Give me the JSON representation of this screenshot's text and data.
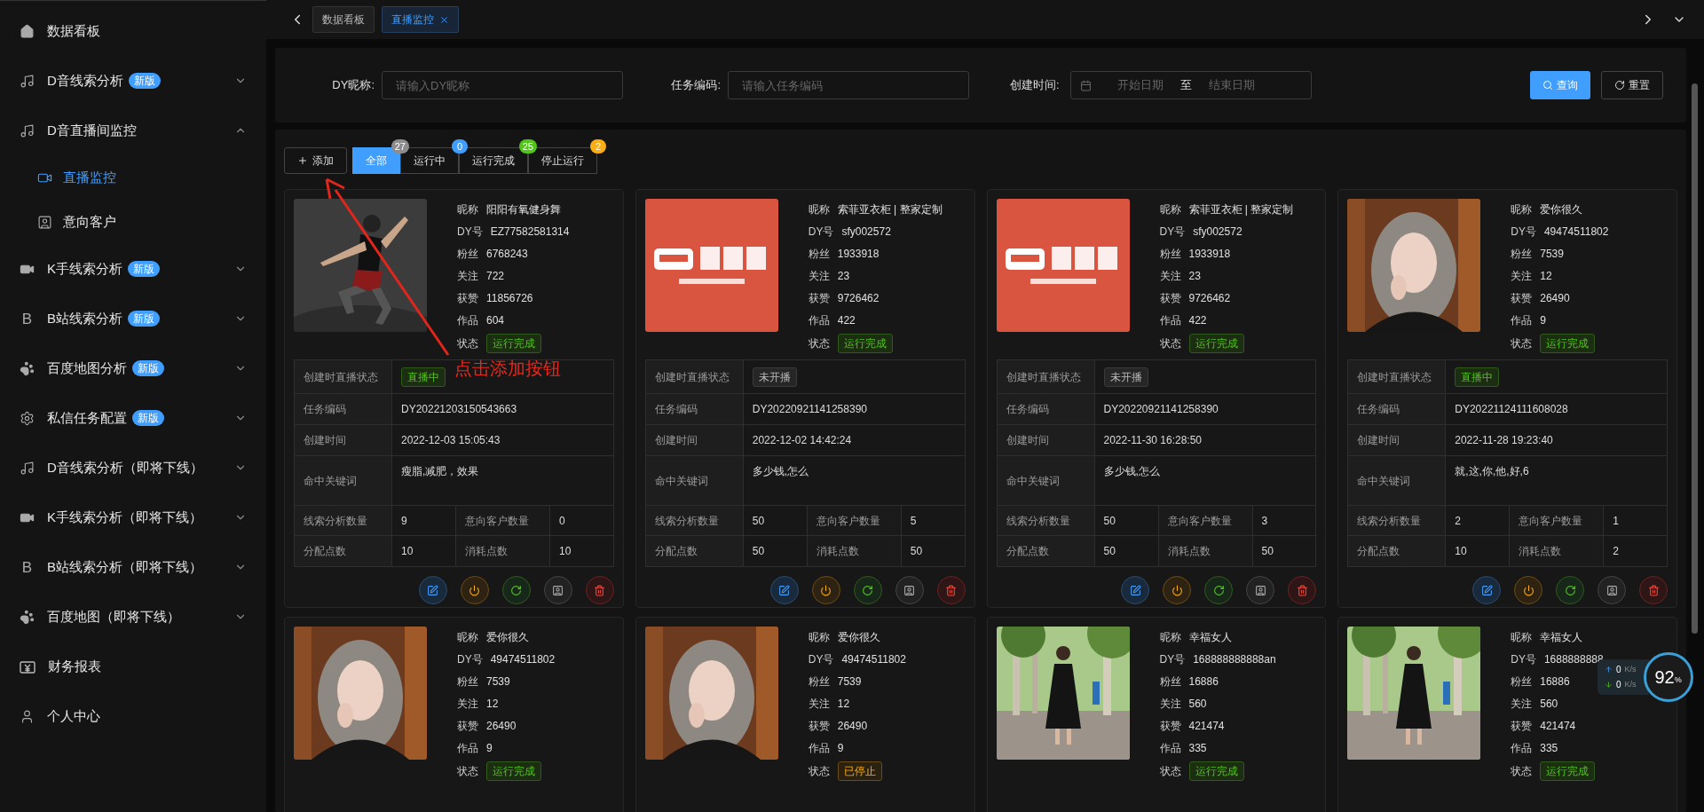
{
  "sidebar": {
    "items": [
      {
        "label": "数据看板",
        "selected": false
      },
      {
        "label": "D音线索分析",
        "badge": "新版",
        "expanded": false,
        "selected": false
      },
      {
        "label": "D音直播间监控",
        "expanded": true,
        "selected": false,
        "children": [
          {
            "label": "直播监控",
            "selected": true
          },
          {
            "label": "意向客户",
            "selected": false
          }
        ]
      },
      {
        "label": "K手线索分析",
        "badge": "新版",
        "expanded": false,
        "selected": false
      },
      {
        "label": "B站线索分析",
        "icon_text": "B",
        "badge": "新版",
        "expanded": false,
        "selected": false
      },
      {
        "label": "百度地图分析",
        "badge": "新版",
        "expanded": false,
        "selected": false
      },
      {
        "label": "私信任务配置",
        "badge": "新版",
        "expanded": false,
        "selected": false
      },
      {
        "label": "D音线索分析（即将下线）",
        "expanded": false,
        "selected": false
      },
      {
        "label": "K手线索分析（即将下线）",
        "expanded": false,
        "selected": false
      },
      {
        "label": "B站线索分析（即将下线）",
        "icon_text": "B",
        "expanded": false,
        "selected": false
      },
      {
        "label": "百度地图（即将下线）",
        "expanded": false,
        "selected": false
      },
      {
        "label": "财务报表",
        "selected": false
      },
      {
        "label": "个人中心",
        "selected": false
      }
    ]
  },
  "tabs": [
    {
      "label": "数据看板",
      "selected": false,
      "closable": false
    },
    {
      "label": "直播监控",
      "selected": true,
      "closable": true
    }
  ],
  "filters": {
    "fields": [
      {
        "label": "DY昵称:",
        "placeholder": "请输入DY昵称"
      },
      {
        "label": "任务编码:",
        "placeholder": "请输入任务编码"
      }
    ],
    "date_range": {
      "label": "创建时间:",
      "start_placeholder": "开始日期",
      "separator": "至",
      "end_placeholder": "结束日期"
    },
    "buttons": [
      {
        "label": "查询",
        "kind": "primary"
      },
      {
        "label": "重置",
        "kind": "default"
      }
    ]
  },
  "toolbar": {
    "add_button": "添加",
    "segments": [
      {
        "label": "全部",
        "selected": true,
        "badge": "27",
        "color": "#8c8c8c"
      },
      {
        "label": "运行中",
        "selected": false,
        "badge": "0",
        "color": "#409eff"
      },
      {
        "label": "运行完成",
        "selected": false,
        "badge": "25",
        "color": "#52c41a"
      },
      {
        "label": "停止运行",
        "selected": false,
        "badge": "2",
        "color": "#faad14"
      }
    ]
  },
  "cards": [
    {
      "fields": [
        {
          "label": "昵称",
          "value": "阳阳有氧健身舞"
        },
        {
          "label": "DY号",
          "value": "EZ77582581314"
        },
        {
          "label": "粉丝",
          "value": "6768243"
        },
        {
          "label": "关注",
          "value": "722"
        },
        {
          "label": "获赞",
          "value": "11856726"
        },
        {
          "label": "作品",
          "value": "604"
        }
      ],
      "status": {
        "label": "状态",
        "text": "运行完成",
        "kind": "done"
      },
      "details": [
        {
          "label": "创建时直播状态",
          "kind": "tag",
          "tag": {
            "text": "直播中",
            "kind": "live"
          }
        },
        {
          "label": "任务编码",
          "kind": "text",
          "value": "DY20221203150543663"
        },
        {
          "label": "创建时间",
          "kind": "text",
          "value": "2022-12-03 15:05:43"
        },
        {
          "label": "命中关键词",
          "kind": "multiline",
          "value": "瘦脂,减肥，效果"
        }
      ],
      "stats": [
        [
          {
            "label": "线索分析数量",
            "value": "9"
          },
          {
            "label": "意向客户数量",
            "value": "0"
          }
        ],
        [
          {
            "label": "分配点数",
            "value": "10"
          },
          {
            "label": "消耗点数",
            "value": "10"
          }
        ]
      ]
    },
    {
      "fields": [
        {
          "label": "昵称",
          "value": "索菲亚衣柜 | 整家定制"
        },
        {
          "label": "DY号",
          "value": "sfy002572"
        },
        {
          "label": "粉丝",
          "value": "1933918"
        },
        {
          "label": "关注",
          "value": "23"
        },
        {
          "label": "获赞",
          "value": "9726462"
        },
        {
          "label": "作品",
          "value": "422"
        }
      ],
      "status": {
        "label": "状态",
        "text": "运行完成",
        "kind": "done"
      },
      "details": [
        {
          "label": "创建时直播状态",
          "kind": "tag",
          "tag": {
            "text": "未开播",
            "kind": "idle"
          }
        },
        {
          "label": "任务编码",
          "kind": "text",
          "value": "DY20220921141258390"
        },
        {
          "label": "创建时间",
          "kind": "text",
          "value": "2022-12-02 14:42:24"
        },
        {
          "label": "命中关键词",
          "kind": "multiline",
          "value": "多少钱,怎么"
        }
      ],
      "stats": [
        [
          {
            "label": "线索分析数量",
            "value": "50"
          },
          {
            "label": "意向客户数量",
            "value": "5"
          }
        ],
        [
          {
            "label": "分配点数",
            "value": "50"
          },
          {
            "label": "消耗点数",
            "value": "50"
          }
        ]
      ]
    },
    {
      "fields": [
        {
          "label": "昵称",
          "value": "索菲亚衣柜 | 整家定制"
        },
        {
          "label": "DY号",
          "value": "sfy002572"
        },
        {
          "label": "粉丝",
          "value": "1933918"
        },
        {
          "label": "关注",
          "value": "23"
        },
        {
          "label": "获赞",
          "value": "9726462"
        },
        {
          "label": "作品",
          "value": "422"
        }
      ],
      "status": {
        "label": "状态",
        "text": "运行完成",
        "kind": "done"
      },
      "details": [
        {
          "label": "创建时直播状态",
          "kind": "tag",
          "tag": {
            "text": "未开播",
            "kind": "idle"
          }
        },
        {
          "label": "任务编码",
          "kind": "text",
          "value": "DY20220921141258390"
        },
        {
          "label": "创建时间",
          "kind": "text",
          "value": "2022-11-30 16:28:50"
        },
        {
          "label": "命中关键词",
          "kind": "multiline",
          "value": "多少钱,怎么"
        }
      ],
      "stats": [
        [
          {
            "label": "线索分析数量",
            "value": "50"
          },
          {
            "label": "意向客户数量",
            "value": "3"
          }
        ],
        [
          {
            "label": "分配点数",
            "value": "50"
          },
          {
            "label": "消耗点数",
            "value": "50"
          }
        ]
      ]
    },
    {
      "fields": [
        {
          "label": "昵称",
          "value": "爱你很久"
        },
        {
          "label": "DY号",
          "value": "49474511802"
        },
        {
          "label": "粉丝",
          "value": "7539"
        },
        {
          "label": "关注",
          "value": "12"
        },
        {
          "label": "获赞",
          "value": "26490"
        },
        {
          "label": "作品",
          "value": "9"
        }
      ],
      "status": {
        "label": "状态",
        "text": "运行完成",
        "kind": "done"
      },
      "details": [
        {
          "label": "创建时直播状态",
          "kind": "tag",
          "tag": {
            "text": "直播中",
            "kind": "live"
          }
        },
        {
          "label": "任务编码",
          "kind": "text",
          "value": "DY20221124111608028"
        },
        {
          "label": "创建时间",
          "kind": "text",
          "value": "2022-11-28 19:23:40"
        },
        {
          "label": "命中关键词",
          "kind": "multiline",
          "value": "就,这,你,他,好,6"
        }
      ],
      "stats": [
        [
          {
            "label": "线索分析数量",
            "value": "2"
          },
          {
            "label": "意向客户数量",
            "value": "1"
          }
        ],
        [
          {
            "label": "分配点数",
            "value": "10"
          },
          {
            "label": "消耗点数",
            "value": "2"
          }
        ]
      ]
    },
    {
      "fields": [
        {
          "label": "昵称",
          "value": "爱你很久"
        },
        {
          "label": "DY号",
          "value": "49474511802"
        },
        {
          "label": "粉丝",
          "value": "7539"
        },
        {
          "label": "关注",
          "value": "12"
        },
        {
          "label": "获赞",
          "value": "26490"
        },
        {
          "label": "作品",
          "value": "9"
        }
      ],
      "status": {
        "label": "状态",
        "text": "运行完成",
        "kind": "done"
      }
    },
    {
      "fields": [
        {
          "label": "昵称",
          "value": "爱你很久"
        },
        {
          "label": "DY号",
          "value": "49474511802"
        },
        {
          "label": "粉丝",
          "value": "7539"
        },
        {
          "label": "关注",
          "value": "12"
        },
        {
          "label": "获赞",
          "value": "26490"
        },
        {
          "label": "作品",
          "value": "9"
        }
      ],
      "status": {
        "label": "状态",
        "text": "已停止",
        "kind": "stopped"
      }
    },
    {
      "fields": [
        {
          "label": "昵称",
          "value": "幸福女人"
        },
        {
          "label": "DY号",
          "value": "168888888888an"
        },
        {
          "label": "粉丝",
          "value": "16886"
        },
        {
          "label": "关注",
          "value": "560"
        },
        {
          "label": "获赞",
          "value": "421474"
        },
        {
          "label": "作品",
          "value": "335"
        }
      ],
      "status": {
        "label": "状态",
        "text": "运行完成",
        "kind": "done"
      }
    },
    {
      "fields": [
        {
          "label": "昵称",
          "value": "幸福女人"
        },
        {
          "label": "DY号",
          "value": "1688888888"
        },
        {
          "label": "粉丝",
          "value": "16886"
        },
        {
          "label": "关注",
          "value": "560"
        },
        {
          "label": "获赞",
          "value": "421474"
        },
        {
          "label": "作品",
          "value": "335"
        }
      ],
      "status": {
        "label": "状态",
        "text": "运行完成",
        "kind": "done"
      }
    }
  ],
  "annotation": {
    "text": "点击添加按钮"
  },
  "net_widget": {
    "upload": "0",
    "download": "0",
    "unit_up": "K/s",
    "unit_down": "K/s",
    "percent": "92",
    "percent_sign": "%"
  }
}
